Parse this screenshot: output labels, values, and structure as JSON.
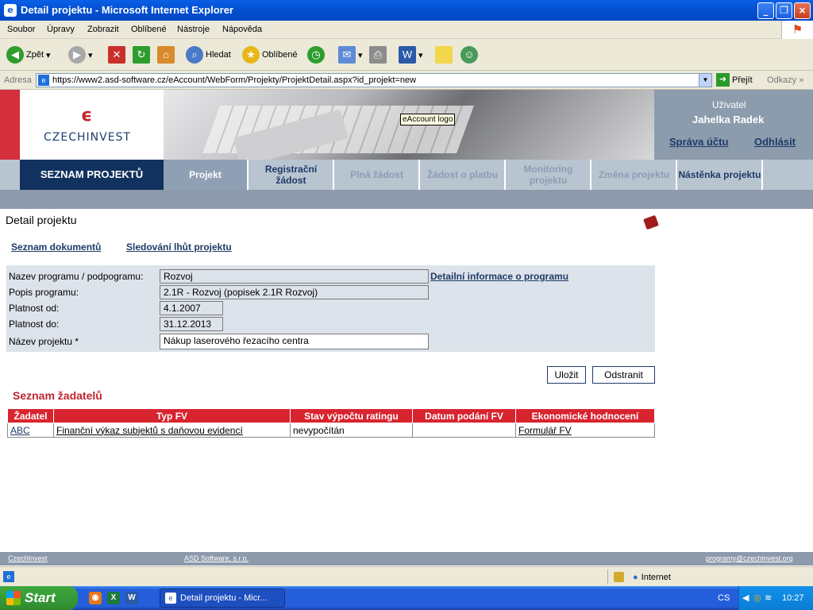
{
  "window": {
    "title": "Detail projektu - Microsoft Internet Explorer"
  },
  "menu": [
    "Soubor",
    "Úpravy",
    "Zobrazit",
    "Oblíbené",
    "Nástroje",
    "Nápověda"
  ],
  "toolbar": {
    "back": "Zpět",
    "search": "Hledat",
    "favorites": "Oblíbené"
  },
  "address": {
    "label": "Adresa",
    "url": "https://www2.asd-software.cz/eAccount/WebForm/Projekty/ProjektDetail.aspx?id_projekt=new",
    "go": "Přejít",
    "links": "Odkazy"
  },
  "header": {
    "logo_text": "CZECHINVEST",
    "tooltip": "eAccount logo",
    "user_label": "Uživatel",
    "user_name": "Jahelka Radek",
    "account_link": "Správa účtu",
    "logout_link": "Odhlásit"
  },
  "nav": {
    "left": "SEZNAM PROJEKTŮ",
    "tabs": [
      "Projekt",
      "Registrační žádost",
      "Plná žádost",
      "Žádost o platbu",
      "Monitoring projektu",
      "Změna projektu",
      "Nástěnka projektu"
    ]
  },
  "page": {
    "title": "Detail projektu",
    "doc_link": "Seznam dokumentů",
    "deadline_link": "Sledování lhůt projektu"
  },
  "form": {
    "program_label": "Nazev programu / podpogramu:",
    "program_value": "Rozvoj",
    "program_detail_link": "Detailní informace o programu",
    "desc_label": "Popis programu:",
    "desc_value": "2.1R - Rozvoj (popisek 2.1R Rozvoj)",
    "from_label": "Platnost od:",
    "from_value": "4.1.2007",
    "to_label": "Platnost do:",
    "to_value": "31.12.2013",
    "name_label": "Název projektu *",
    "name_value": "Nákup laserového řezacího centra"
  },
  "buttons": {
    "save": "Uložit",
    "delete": "Odstranit"
  },
  "applicants": {
    "title": "Seznam žadatelů",
    "columns": [
      "Žadatel",
      "Typ FV",
      "Stav výpočtu ratingu",
      "Datum podání FV",
      "Ekonomické hodnocení"
    ],
    "rows": [
      [
        "ABC",
        "Finanční výkaz subjektů s daňovou evidencí",
        "nevypočítán",
        "",
        "Formulář FV"
      ]
    ]
  },
  "footer": {
    "left": "CzechInvest",
    "mid": "ASD Software, s.r.o.",
    "right": "programy@czechinvest.org"
  },
  "status": {
    "zone": "Internet"
  },
  "taskbar": {
    "start": "Start",
    "task": "Detail projektu - Micr...",
    "lang": "CS",
    "clock": "10:27"
  }
}
